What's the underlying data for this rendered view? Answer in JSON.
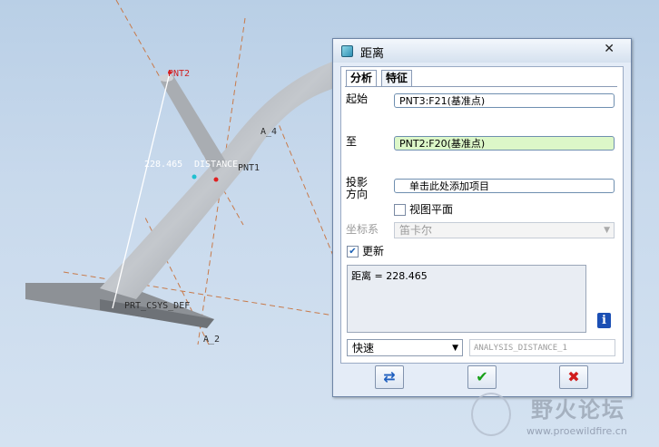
{
  "viewport": {
    "labels": {
      "pnt2": "PNT2",
      "a4": "A_4",
      "distance_value": "228.465",
      "distance": "DISTANCE",
      "pnt1": "PNT1",
      "csys": "PRT_CSYS_DEF",
      "a2": "A_2"
    }
  },
  "dialog": {
    "title": "距离",
    "tabs": [
      "分析",
      "特征"
    ],
    "from_label": "起始",
    "from_value": "PNT3:F21(基准点)",
    "to_label": "至",
    "to_value": "PNT2:F20(基准点)",
    "projection_label_1": "投影",
    "projection_label_2": "方向",
    "projection_placeholder": "单击此处添加项目",
    "view_plane_label": "视图平面",
    "csys_label": "坐标系",
    "csys_value": "笛卡尔",
    "update_label": "更新",
    "result_text": "距离  = 228.465",
    "speed_value": "快速",
    "feature_name": "ANALYSIS_DISTANCE_1"
  },
  "watermark": {
    "text": "野火论坛",
    "url": "www.proewildfire.cn"
  },
  "colors": {
    "to_field_bg": "#dcf7c8",
    "ok": "#18a018",
    "cancel": "#d01c1c",
    "info": "#1b4fb4"
  }
}
